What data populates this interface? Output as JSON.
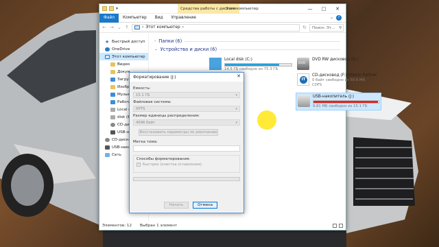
{
  "titlebar": {
    "context_tab": "Средства работы с дисками",
    "window_title": "Этот компьютер",
    "controls": [
      "—",
      "□",
      "✕"
    ]
  },
  "ribbon": {
    "tabs": [
      "Файл",
      "Компьютер",
      "Вид",
      "Управление"
    ]
  },
  "address": {
    "path": "Этот компьютер",
    "separator": "›",
    "search_placeholder": "Поиск: Эт..."
  },
  "nav": {
    "items": [
      {
        "label": "Быстрый доступ",
        "icon": "star-icon"
      },
      {
        "label": "OneDrive",
        "icon": "cloud-icon"
      },
      {
        "label": "Этот компьютер",
        "icon": "computer-icon",
        "selected": true
      },
      {
        "label": "Видео",
        "icon": "folder-icon"
      },
      {
        "label": "Докум",
        "icon": "folder-icon"
      },
      {
        "label": "Загруз",
        "icon": "folder-icon"
      },
      {
        "label": "Изобр",
        "icon": "folder-icon"
      },
      {
        "label": "Музык",
        "icon": "folder-icon"
      },
      {
        "label": "Рабоч",
        "icon": "folder-icon"
      },
      {
        "label": "Local d",
        "icon": "drive-icon"
      },
      {
        "label": "disk (E:)",
        "icon": "drive-icon"
      },
      {
        "label": "CD-диск",
        "icon": "cd-icon"
      },
      {
        "label": "USB-нак",
        "icon": "usb-icon"
      },
      {
        "label": "CD-дисково",
        "icon": "cd-icon"
      },
      {
        "label": "USB-накопи",
        "icon": "usb-icon"
      },
      {
        "label": "Сеть",
        "icon": "network-icon"
      }
    ]
  },
  "groups": {
    "folders": "Папки (6)",
    "devices": "Устройства и диски (6)"
  },
  "drives": {
    "local_c": {
      "name": "Local disk (C:)",
      "free": "14.5 ГБ свободно из 75.3 ГБ",
      "used_fraction": 0.81
    },
    "dvd": {
      "name": "DVD RW дисковод (D:)"
    },
    "cd_f": {
      "name": "CD-дисковод (F:) Mobile Partner",
      "free": "0 байт свободно из 50.6 МБ",
      "fs": "CDFS"
    },
    "usb_j": {
      "name": "USB-накопитель (J:)",
      "free": "9.81 МБ свободно из 15.1 ГБ",
      "used_fraction": 0.99
    }
  },
  "status": {
    "items": "Элементов: 12",
    "selected": "Выбран 1 элемент"
  },
  "dialog": {
    "title": "Форматирование (J:)",
    "capacity_label": "Емкость:",
    "capacity_value": "15.1 ГБ",
    "fs_label": "Файловая система:",
    "fs_value": "NTFS",
    "cluster_label": "Размер единицы распределения:",
    "cluster_value": "4096 байт",
    "restore_button": "Восстановить параметры по умолчанию",
    "volume_label": "Метка тома:",
    "volume_value": "",
    "methods_legend": "Способы форматирования:",
    "quick_format": "Быстрое (очистка оглавления)",
    "start_button": "Начать",
    "cancel_button": "Отмена"
  }
}
